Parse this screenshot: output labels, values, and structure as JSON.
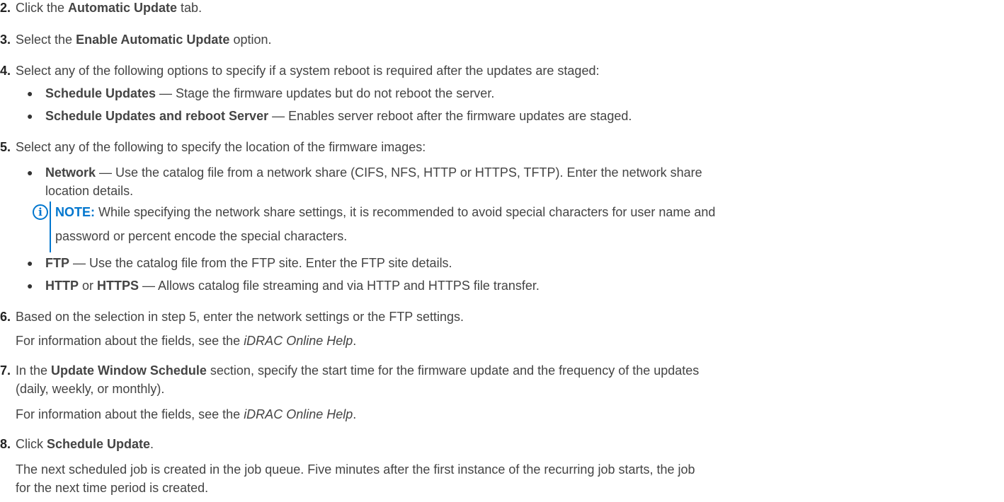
{
  "steps": [
    {
      "num": "2.",
      "pre": "Click the ",
      "bold": "Automatic Update",
      "post": " tab."
    },
    {
      "num": "3.",
      "pre": "Select the ",
      "bold": "Enable Automatic Update",
      "post": " option."
    },
    {
      "num": "4.",
      "text": "Select any of the following options to specify if a system reboot is required after the updates are staged:"
    },
    {
      "num": "5.",
      "text": "Select any of the following to specify the location of the firmware images:"
    },
    {
      "num": "6.",
      "text": "Based on the selection in step 5, enter the network settings or the FTP settings."
    },
    {
      "num": "7.",
      "pre": "In the ",
      "bold": "Update Window Schedule",
      "post": " section, specify the start time for the firmware update and the frequency of the updates",
      "cont": "(daily, weekly, or monthly)."
    },
    {
      "num": "8.",
      "pre": "Click ",
      "bold": "Schedule Update",
      "post": "."
    }
  ],
  "step4_bullets": [
    {
      "bold": "Schedule Updates",
      "text": " — Stage the firmware updates but do not reboot the server."
    },
    {
      "bold": "Schedule Updates and reboot Server",
      "text": " — Enables server reboot after the firmware updates are staged."
    }
  ],
  "step5_bullets": [
    {
      "bold": "Network",
      "text": " — Use the catalog file from a network share (CIFS, NFS, HTTP or HTTPS, TFTP). Enter the network share",
      "cont": "location details."
    },
    {
      "bold": "FTP",
      "text": " — Use the catalog file from the FTP site. Enter the FTP site details."
    },
    {
      "bold": "HTTP",
      "mid": " or ",
      "bold2": "HTTPS",
      "text": " — Allows catalog file streaming and via HTTP and HTTPS file transfer."
    }
  ],
  "note": {
    "label": "NOTE:",
    "text": " While specifying the network share settings, it is recommended to avoid special characters for user name and",
    "cont": "password or percent encode the special characters."
  },
  "help": {
    "pre": "For information about the fields, see the ",
    "italic": "iDRAC Online Help",
    "post": "."
  },
  "step8_result": {
    "line1": "The next scheduled job is created in the job queue. Five minutes after the first instance of the recurring job starts, the job",
    "line2": "for the next time period is created."
  }
}
